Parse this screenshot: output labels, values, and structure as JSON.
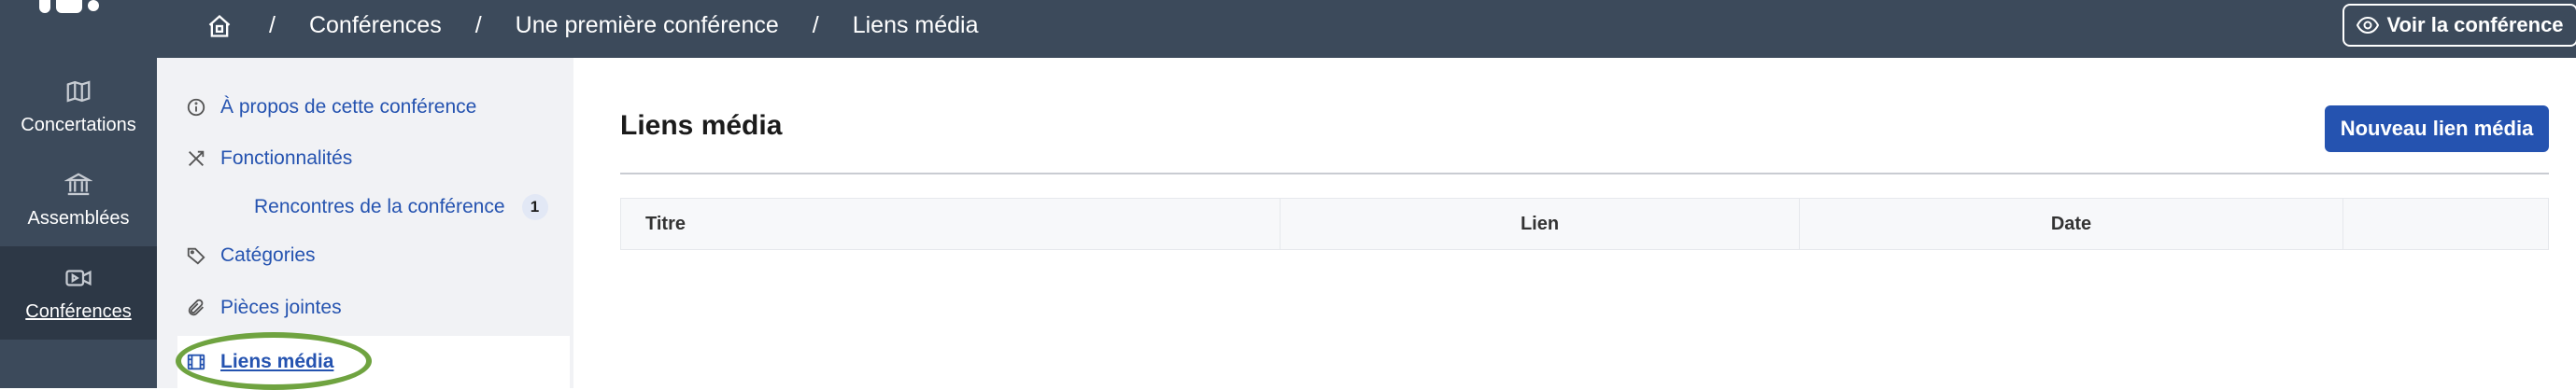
{
  "header": {
    "breadcrumbs": [
      "Conférences",
      "Une première conférence",
      "Liens média"
    ],
    "separator": "/",
    "view_button_label": "Voir la conférence"
  },
  "rail": {
    "items": [
      {
        "label": "Concertations",
        "icon": "map-icon"
      },
      {
        "label": "Assemblées",
        "icon": "institution-icon"
      },
      {
        "label": "Conférences",
        "icon": "video-icon",
        "active": true
      }
    ]
  },
  "subnav": {
    "items": [
      {
        "label": "À propos de cette conférence",
        "icon": "info-icon"
      },
      {
        "label": "Fonctionnalités",
        "icon": "tools-icon"
      },
      {
        "label": "Rencontres de la conférence",
        "badge": "1"
      },
      {
        "label": "Catégories",
        "icon": "tag-icon"
      },
      {
        "label": "Pièces jointes",
        "icon": "paperclip-icon"
      },
      {
        "label": "Liens média",
        "icon": "film-icon",
        "active": true
      }
    ]
  },
  "main": {
    "title": "Liens média",
    "new_button_label": "Nouveau lien média",
    "table": {
      "columns": [
        "Titre",
        "Lien",
        "Date",
        ""
      ],
      "rows": []
    }
  },
  "colors": {
    "topbar": "#3c4a5b",
    "primary": "#2553b0",
    "highlight_ring": "#6fa340"
  }
}
